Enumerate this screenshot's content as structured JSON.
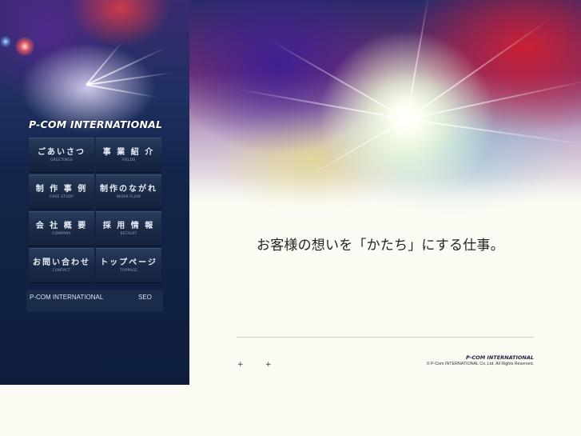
{
  "brand": {
    "logo_text": "P-COM INTERNATIONAL",
    "accent": "#0e1d3c"
  },
  "nav": {
    "items": [
      {
        "label": "ごあいさつ",
        "sub": "GREETINGS"
      },
      {
        "label": "事 業 紹 介",
        "sub": "FIELDS"
      },
      {
        "label": "制 作 事 例",
        "sub": "CASE STUDY"
      },
      {
        "label": "制作のながれ",
        "sub": "WORK FLOW"
      },
      {
        "label": "会 社 概 要",
        "sub": "COMPANY"
      },
      {
        "label": "採 用 情 報",
        "sub": "RECRUIT"
      },
      {
        "label": "お問い合わせ",
        "sub": "CONTACT"
      },
      {
        "label": "トップページ",
        "sub": "TOPPAGE"
      }
    ]
  },
  "subnav": {
    "left_link": "P-COM INTERNATIONAL",
    "right_link": "SEO"
  },
  "hero": {
    "tagline": "お客様の想いを「かたち」にする仕事。"
  },
  "footer": {
    "plus_1": "+",
    "plus_2": "+",
    "logo_text": "P-COM INTERNATIONAL",
    "copyright": "© P-Com INTERNATIONAL Co.,Ltd. All Rights Reserved."
  }
}
